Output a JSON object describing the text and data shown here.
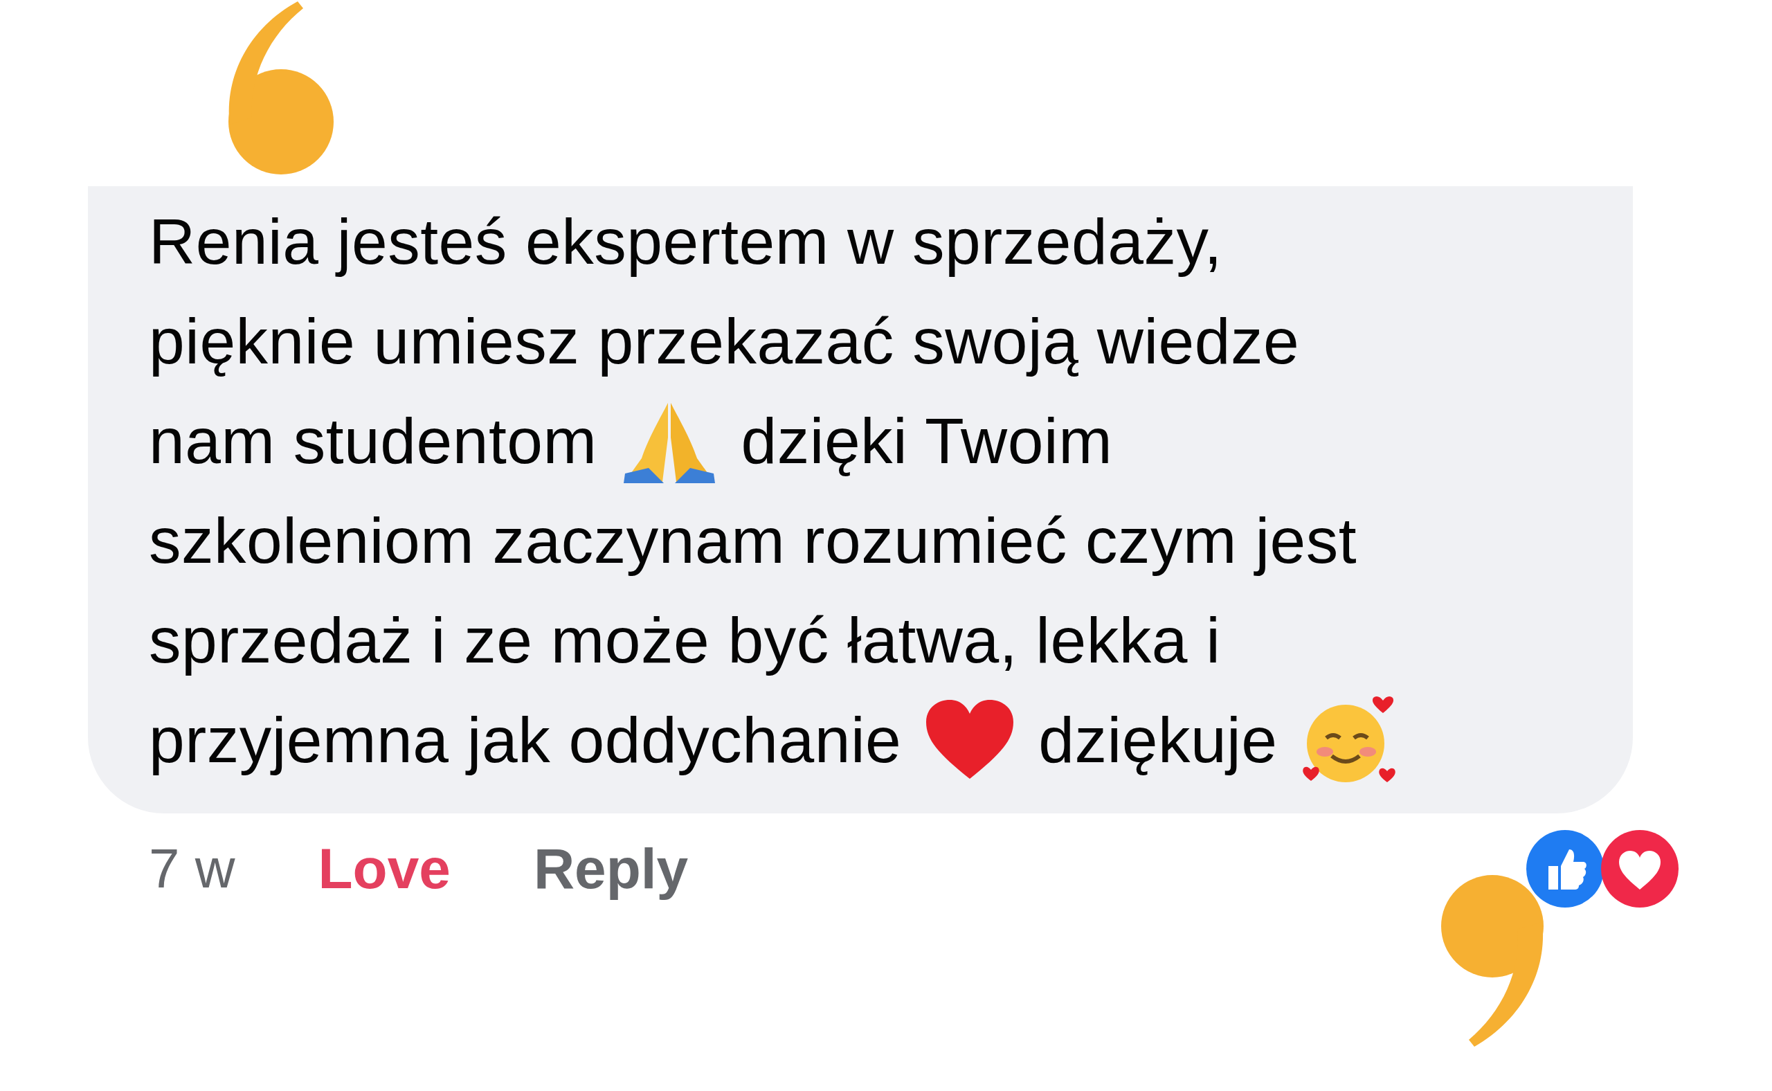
{
  "comment": {
    "lines": [
      [
        {
          "kind": "text",
          "text": "Renia jesteś ekspertem w sprzedaży,"
        }
      ],
      [
        {
          "kind": "text",
          "text": "pięknie umiesz przekazać swoją wiedze"
        }
      ],
      [
        {
          "kind": "text",
          "text": "nam studentom"
        },
        {
          "kind": "pray"
        },
        {
          "kind": "text",
          "text": "dzięki Twoim"
        }
      ],
      [
        {
          "kind": "text",
          "text": "szkoleniom zaczynam rozumieć czym jest"
        }
      ],
      [
        {
          "kind": "text",
          "text": "sprzedaż i ze może być łatwa, lekka i"
        }
      ],
      [
        {
          "kind": "text",
          "text": "przyjemna jak oddychanie"
        },
        {
          "kind": "heart"
        },
        {
          "kind": "text",
          "text": "dziękuje"
        },
        {
          "kind": "smile"
        }
      ]
    ]
  },
  "footer": {
    "time": "7 w",
    "love": {
      "label": "Love",
      "selected": true
    },
    "reply": "Reply"
  }
}
